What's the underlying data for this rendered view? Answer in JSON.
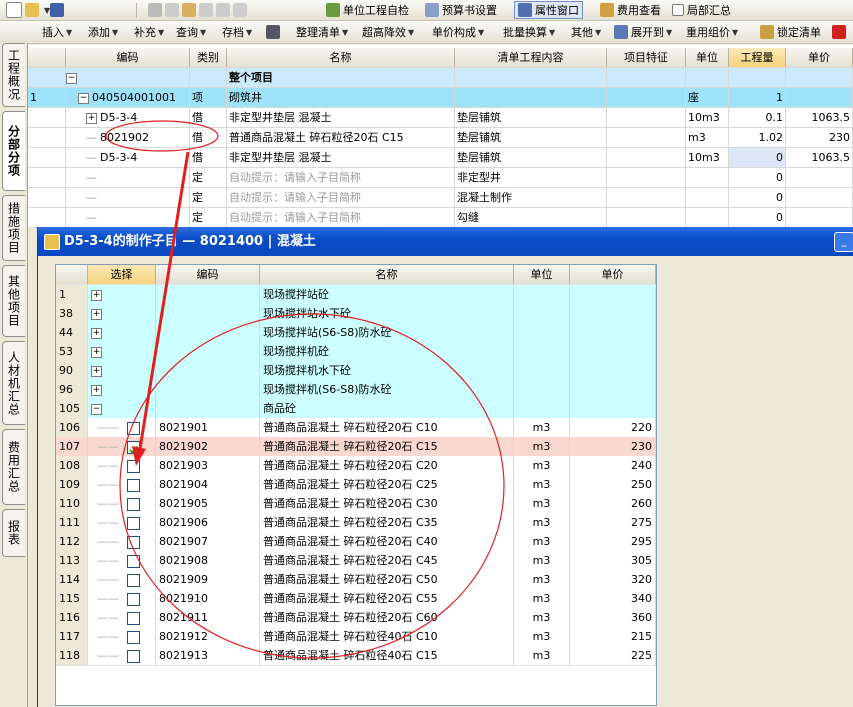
{
  "toolbar1": {
    "unit_check": "单位工程自检",
    "budget_settings": "预算书设置",
    "property_window": "属性窗口",
    "fee_view": "费用查看",
    "partial_summary": "局部汇总"
  },
  "toolbar2": {
    "insert": "插入",
    "add": "添加",
    "supplement": "补充",
    "query": "查询",
    "save": "存档",
    "organize": "整理清单",
    "super_high": "超高降效",
    "unit_price_comp": "单价构成",
    "batch_convert": "批量换算",
    "other": "其他",
    "expand_to": "展开到",
    "reuse_price": "重用组价",
    "lock_list": "锁定清单"
  },
  "left_tabs": [
    {
      "label": "工程概况"
    },
    {
      "label": "分部分项"
    },
    {
      "label": "措施项目"
    },
    {
      "label": "其他项目"
    },
    {
      "label": "人材机汇总"
    },
    {
      "label": "费用汇总"
    },
    {
      "label": "报表"
    }
  ],
  "main_grid": {
    "headers": {
      "code": "编码",
      "type": "类别",
      "name": "名称",
      "content": "清单工程内容",
      "feature": "项目特征",
      "unit": "单位",
      "qty": "工程量",
      "price": "单价"
    },
    "rows": [
      {
        "idx": "",
        "tree": "−",
        "code": "",
        "type": "",
        "name": "整个项目",
        "content": "",
        "unit": "",
        "qty": "",
        "price": ""
      },
      {
        "idx": "1",
        "tree": "−",
        "code": "040504001001",
        "type": "项",
        "name": "砌筑井",
        "content": "",
        "unit": "座",
        "qty": "1",
        "price": ""
      },
      {
        "idx": "",
        "tree": "+",
        "code": "D5-3-4",
        "type": "借",
        "name": "非定型井垫层 混凝土",
        "content": "垫层铺筑",
        "unit": "10m3",
        "qty": "0.1",
        "price": "1063.5"
      },
      {
        "idx": "",
        "tree": "",
        "code": "8021902",
        "type": "借",
        "name": "普通商品混凝土 碎石粒径20石 C15",
        "content": "垫层铺筑",
        "unit": "m3",
        "qty": "1.02",
        "price": "230"
      },
      {
        "idx": "",
        "tree": "",
        "code": "D5-3-4",
        "type": "借",
        "name": "非定型井垫层 混凝土",
        "content": "垫层铺筑",
        "unit": "10m3",
        "qty": "0",
        "price": "1063.5"
      },
      {
        "idx": "",
        "tree": "",
        "code": "",
        "type": "定",
        "name": "自动提示：请输入子目简称",
        "content": "非定型井",
        "unit": "",
        "qty": "0",
        "price": ""
      },
      {
        "idx": "",
        "tree": "",
        "code": "",
        "type": "定",
        "name": "自动提示：请输入子目简称",
        "content": "混凝土制作",
        "unit": "",
        "qty": "0",
        "price": ""
      },
      {
        "idx": "",
        "tree": "",
        "code": "",
        "type": "定",
        "name": "自动提示：请输入子目简称",
        "content": "勾缝",
        "unit": "",
        "qty": "0",
        "price": ""
      }
    ]
  },
  "dialog": {
    "title": "D5-3-4的制作子目 — 8021400 | 混凝土",
    "headers": {
      "select": "选择",
      "code": "编码",
      "name": "名称",
      "unit": "单位",
      "price": "单价"
    },
    "groups": [
      {
        "idx": "1",
        "name": "现场搅拌站砼"
      },
      {
        "idx": "38",
        "name": "现场搅拌站水下砼"
      },
      {
        "idx": "44",
        "name": "现场搅拌站(S6-S8)防水砼"
      },
      {
        "idx": "53",
        "name": "现场搅拌机砼"
      },
      {
        "idx": "90",
        "name": "现场搅拌机水下砼"
      },
      {
        "idx": "96",
        "name": "现场搅拌机(S6-S8)防水砼"
      },
      {
        "idx": "105",
        "name": "商品砼"
      }
    ],
    "items": [
      {
        "idx": "106",
        "code": "8021901",
        "name": "普通商品混凝土 碎石粒径20石 C10",
        "unit": "m3",
        "price": "220",
        "checked": false
      },
      {
        "idx": "107",
        "code": "8021902",
        "name": "普通商品混凝土 碎石粒径20石 C15",
        "unit": "m3",
        "price": "230",
        "checked": true
      },
      {
        "idx": "108",
        "code": "8021903",
        "name": "普通商品混凝土 碎石粒径20石 C20",
        "unit": "m3",
        "price": "240",
        "checked": false
      },
      {
        "idx": "109",
        "code": "8021904",
        "name": "普通商品混凝土 碎石粒径20石 C25",
        "unit": "m3",
        "price": "250",
        "checked": false
      },
      {
        "idx": "110",
        "code": "8021905",
        "name": "普通商品混凝土 碎石粒径20石 C30",
        "unit": "m3",
        "price": "260",
        "checked": false
      },
      {
        "idx": "111",
        "code": "8021906",
        "name": "普通商品混凝土 碎石粒径20石 C35",
        "unit": "m3",
        "price": "275",
        "checked": false
      },
      {
        "idx": "112",
        "code": "8021907",
        "name": "普通商品混凝土 碎石粒径20石 C40",
        "unit": "m3",
        "price": "295",
        "checked": false
      },
      {
        "idx": "113",
        "code": "8021908",
        "name": "普通商品混凝土 碎石粒径20石 C45",
        "unit": "m3",
        "price": "305",
        "checked": false
      },
      {
        "idx": "114",
        "code": "8021909",
        "name": "普通商品混凝土 碎石粒径20石 C50",
        "unit": "m3",
        "price": "320",
        "checked": false
      },
      {
        "idx": "115",
        "code": "8021910",
        "name": "普通商品混凝土 碎石粒径20石 C55",
        "unit": "m3",
        "price": "340",
        "checked": false
      },
      {
        "idx": "116",
        "code": "8021911",
        "name": "普通商品混凝土 碎石粒径20石 C60",
        "unit": "m3",
        "price": "360",
        "checked": false
      },
      {
        "idx": "117",
        "code": "8021912",
        "name": "普通商品混凝土 碎石粒径40石 C10",
        "unit": "m3",
        "price": "215",
        "checked": false
      },
      {
        "idx": "118",
        "code": "8021913",
        "name": "普通商品混凝土 碎石粒径40石 C15",
        "unit": "m3",
        "price": "225",
        "checked": false
      }
    ]
  },
  "colors": {
    "selected_row": "#f8d8d0",
    "group_row": "#ccffff",
    "header_blue": "#0a4cc6",
    "annotation": "#e02020"
  }
}
